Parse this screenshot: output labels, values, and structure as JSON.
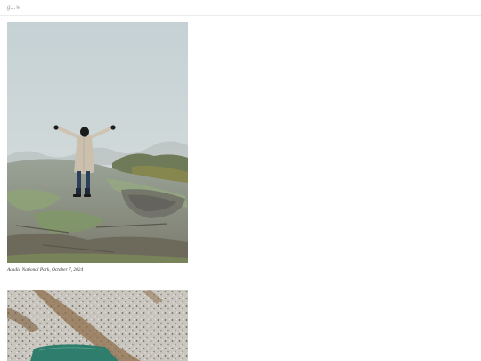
{
  "header": {
    "site_title": "g...w"
  },
  "posts": [
    {
      "image_subject": "person-with-raised-arms-on-foggy-rock",
      "caption": "Acadia National Park, October 7, 2024"
    },
    {
      "image_subject": "granite-with-lichen-and-green-sign",
      "caption": ""
    }
  ],
  "colors": {
    "background": "#ffffff",
    "divider": "#ececec",
    "caption_text": "#3a3a3a",
    "title_text": "#9a9a9a",
    "fog": "#c9d3d6",
    "rock": "#8a8c7e",
    "moss": "#7e9a6a",
    "coat": "#cfc3b3",
    "sign": "#2f7d6c"
  }
}
